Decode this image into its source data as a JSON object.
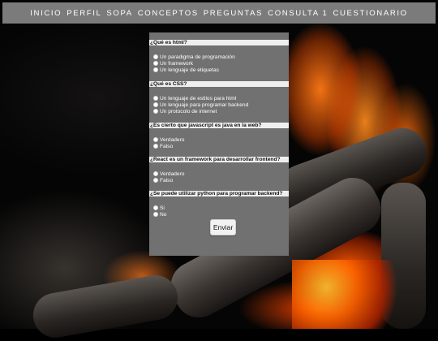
{
  "nav": {
    "items": [
      "INICIO",
      "PERFIL",
      "SOPA",
      "CONCEPTOS",
      "PREGUNTAS",
      "CONSULTA 1",
      "CUESTIONARIO"
    ]
  },
  "quiz": {
    "questions": [
      {
        "title": "¿Qué es html?",
        "options": [
          "Un paradigma de programación",
          "Un framework",
          "Un lenguaje de etiquetas"
        ]
      },
      {
        "title": "¿Qué es CSS?",
        "options": [
          "Un lenguaje de estilos para html",
          "Un lenguaje para programar backend",
          "Un protocolo de internet"
        ]
      },
      {
        "title": "¿Es cierto que javascript es java en la web?",
        "options": [
          "Verdadero",
          "Falso"
        ]
      },
      {
        "title": "¿React es un framework para desarrollar frontend?",
        "options": [
          "Verdadero",
          "Falso"
        ]
      },
      {
        "title": "¿Se puede utilizar python para programar backend?",
        "options": [
          "Si",
          "No"
        ]
      }
    ],
    "submit_label": "Enviar"
  }
}
